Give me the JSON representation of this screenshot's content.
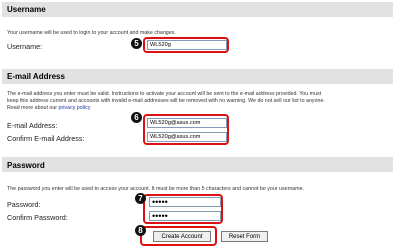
{
  "username_section": {
    "title": "Username",
    "description": "Your username will be used to login to your account and make changes.",
    "username_label": "Username:",
    "username_value": "WL520g",
    "step_badge": "5"
  },
  "email_section": {
    "title": "E-mail Address",
    "desc_line1": "The e-mail address you enter must be valid. Instructions to activate your account will be sent to the e-mail address provided. You must",
    "desc_line2": "keep this address current and accounts with invalid e-mail addresses will be removed with no warning. We do not sell our list to anyone.",
    "desc_line3_prefix": "Read more about our",
    "privacy_link": "privacy policy",
    "email_label": "E-mail Address:",
    "email_value": "WL520g@asus.com",
    "confirm_label": "Confirm E-mail Address:",
    "confirm_value": "WL520g@asus.com",
    "step_badge": "6"
  },
  "password_section": {
    "title": "Password",
    "description": "The password you enter will be used to access your account. It must be more than 5 characters and cannot be your username.",
    "password_label": "Password:",
    "password_value": "•••••",
    "confirm_label": "Confirm Password:",
    "confirm_value": "•••••",
    "step_badge": "7"
  },
  "actions": {
    "create_label": "Create Account",
    "reset_label": "Reset Form",
    "step_badge": "8"
  },
  "colors": {
    "section_bar": "#e2e2e2",
    "highlight": "#d11",
    "link": "#1a3aa8"
  }
}
